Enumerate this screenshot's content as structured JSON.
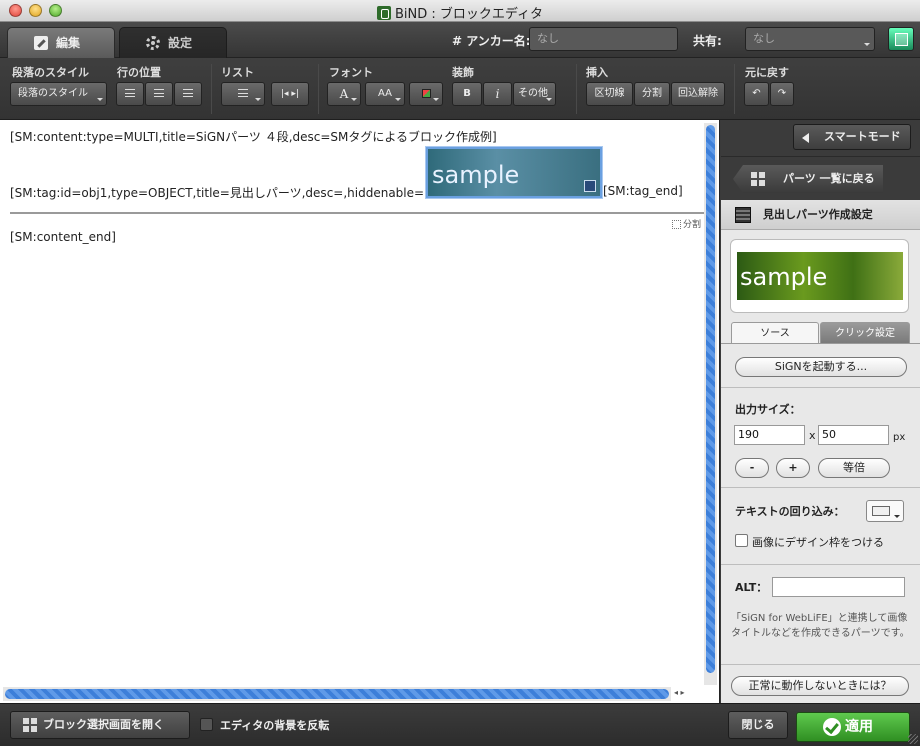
{
  "window": {
    "title": "BiND : ブロックエディタ"
  },
  "tabs": {
    "edit": "編集",
    "settings": "設定"
  },
  "header": {
    "anchor_label": "# アンカー名:",
    "anchor_value": "なし",
    "share_label": "共有:",
    "share_value": "なし"
  },
  "toolbar": {
    "paragraph_style_label": "段落のスタイル",
    "paragraph_style_button": "段落のスタイル",
    "line_position_label": "行の位置",
    "list_label": "リスト",
    "font_label": "フォント",
    "decoration_label": "装飾",
    "bold": "B",
    "italic": "i",
    "other": "その他",
    "insert_label": "挿入",
    "divider": "区切線",
    "split": "分割",
    "wrap_release": "回込解除",
    "undo_label": "元に戻す",
    "font_a": "A",
    "font_aa": "AA"
  },
  "editor": {
    "line1": "[SM:content:type=MULTI,title=SiGNパーツ ４段,desc=SMタグによるブロック作成例]",
    "line2": "[SM:tag:id=obj1,type=OBJECT,title=見出しパーツ,desc=,hiddenable=1]",
    "sample_text": "sample",
    "tag_end": "[SM:tag_end]",
    "split_label": "分割",
    "content_end": "[SM:content_end]"
  },
  "panel": {
    "smart_mode": "スマートモード",
    "back_to_list": "パーツ 一覧に戻る",
    "header": "見出しパーツ作成設定",
    "preview_text": "sample",
    "tab_source": "ソース",
    "tab_click": "クリック設定",
    "launch_sign": "SiGNを起動する...",
    "output_size_label": "出力サイズ：",
    "width": "190",
    "x": "x",
    "height": "50",
    "unit": "px",
    "minus": "-",
    "plus": "+",
    "equal": "等倍",
    "text_wrap_label": "テキストの回り込み：",
    "design_frame_label": "画像にデザイン枠をつける",
    "alt_label": "ALT：",
    "alt_value": "",
    "description": "「SiGN for WebLiFE」と連携して画像タイトルなどを作成できるパーツです。",
    "help_button": "正常に動作しないときには？"
  },
  "bottom": {
    "open_block_select": "ブロック選択画面を開く",
    "invert_bg": "エディタの背景を反転",
    "close": "閉じる",
    "apply": "適用"
  }
}
